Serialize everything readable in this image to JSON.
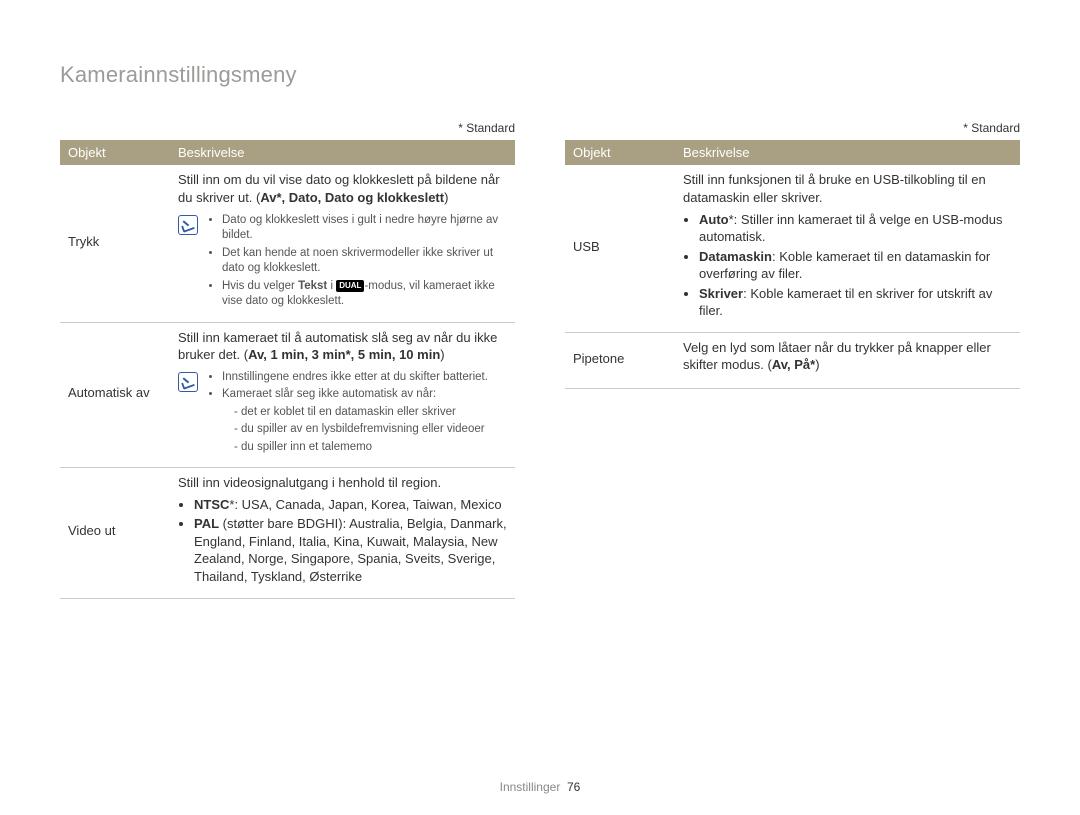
{
  "title": "Kamerainnstillingsmeny",
  "standard_note": "* Standard",
  "headers": {
    "objekt": "Objekt",
    "beskrivelse": "Beskrivelse"
  },
  "mode_icon_label": "DUAL",
  "left": {
    "trykk": {
      "name": "Trykk",
      "desc_prefix": "Still inn om du vil vise dato og klokkeslett på bildene når du skriver ut. (",
      "opts_bold": "Av*, Dato, Dato og klokkeslett",
      "desc_suffix": ")",
      "notes": {
        "n1": "Dato og klokkeslett vises i gult i nedre høyre hjørne av bildet.",
        "n2": "Det kan hende at noen skrivermodeller ikke skriver ut dato og klokkeslett.",
        "n3a": "Hvis du velger ",
        "n3_bold": "Tekst",
        "n3b": " i ",
        "n3c": "-modus, vil kameraet ikke vise dato og klokkeslett."
      }
    },
    "auto_av": {
      "name": "Automatisk av",
      "desc_prefix": "Still inn kameraet til å automatisk slå seg av når du ikke bruker det. (",
      "opts_bold": "Av, 1 min, 3 min*, 5 min, 10 min",
      "desc_suffix": ")",
      "notes": {
        "n1": "Innstillingene endres ikke etter at du skifter batteriet.",
        "n2": "Kameraet slår seg ikke automatisk av når:",
        "sub1": "det er koblet til en datamaskin eller skriver",
        "sub2": "du spiller av en lysbildefremvisning eller videoer",
        "sub3": "du spiller inn et talememo"
      }
    },
    "video": {
      "name": "Video ut",
      "intro": "Still inn videosignalutgang i henhold til region.",
      "ntsc_bold": "NTSC",
      "ntsc_rest": "*: USA, Canada, Japan, Korea, Taiwan, Mexico",
      "pal_bold": "PAL",
      "pal_paren": " (støtter bare BDGHI): ",
      "pal_rest": "Australia, Belgia, Danmark, England, Finland, Italia, Kina, Kuwait, Malaysia, New Zealand, Norge, Singapore, Spania, Sveits, Sverige, Thailand, Tyskland, Østerrike"
    }
  },
  "right": {
    "usb": {
      "name": "USB",
      "intro": "Still inn funksjonen til å bruke en USB-tilkobling til en datamaskin eller skriver.",
      "auto_bold": "Auto",
      "auto_rest": "*: Stiller inn kameraet til å velge en USB-modus automatisk.",
      "data_bold": "Datamaskin",
      "data_rest": ": Koble kameraet til en datamaskin for overføring av filer.",
      "skriv_bold": "Skriver",
      "skriv_rest": ": Koble kameraet til en skriver for utskrift av filer."
    },
    "pipetone": {
      "name": "Pipetone",
      "desc_prefix": "Velg en lyd som låtaer når du trykker på knapper eller skifter modus. (",
      "opts_bold": "Av, På*",
      "desc_suffix": ")"
    }
  },
  "footer": {
    "section": "Innstillinger",
    "page": "76"
  }
}
